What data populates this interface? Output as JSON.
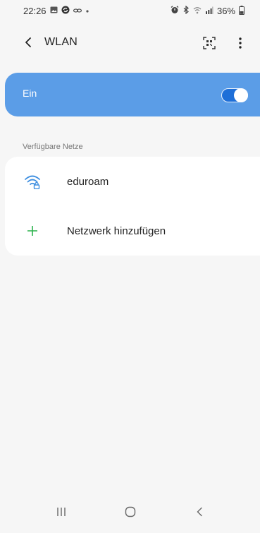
{
  "status_bar": {
    "time": "22:26",
    "battery": "36%",
    "icons_left": [
      "gallery-icon",
      "sync-icon",
      "link-icon",
      "dot-icon"
    ],
    "icons_right": [
      "alarm-icon",
      "bluetooth-icon",
      "wifi-signal-icon",
      "cell-signal-icon",
      "battery-icon"
    ]
  },
  "appbar": {
    "title": "WLAN"
  },
  "wifi_toggle": {
    "label": "Ein",
    "enabled": true,
    "accent_color": "#5b9de7"
  },
  "networks": {
    "section_label": "Verfügbare Netze",
    "items": [
      {
        "label": "eduroam",
        "icon": "wifi-locked-icon"
      },
      {
        "label": "Netzwerk hinzufügen",
        "icon": "plus-icon"
      }
    ]
  },
  "navbar": {
    "buttons": [
      "recent-apps-icon",
      "home-icon",
      "back-icon"
    ]
  }
}
